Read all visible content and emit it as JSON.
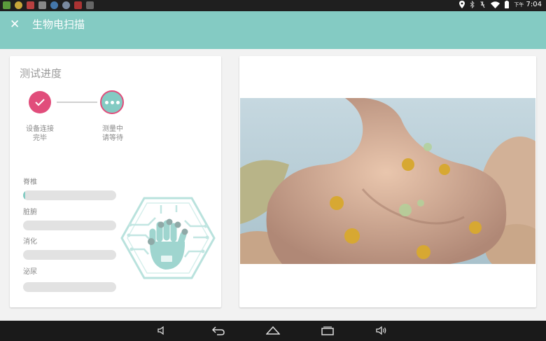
{
  "status_bar": {
    "notification_icons": [
      "gallery-icon",
      "sun-icon",
      "app-icon",
      "image-icon",
      "globe-icon",
      "globe-icon",
      "calendar-icon",
      "app-icon"
    ],
    "ampm": "下午",
    "time": "7:04",
    "battery_color": "#ffffff"
  },
  "app_bar": {
    "title": "生物电扫描",
    "close_icon": "close-icon",
    "color": "#84cbc3"
  },
  "progress": {
    "title": "测试进度",
    "steps": [
      {
        "label": "设备连接\n完毕",
        "state": "done",
        "icon": "check-icon"
      },
      {
        "label": "测量中\n请等待",
        "state": "active",
        "icon": "more-dots-icon"
      }
    ]
  },
  "metrics": [
    {
      "label": "脊椎",
      "progress": 0.02
    },
    {
      "label": "脏腑",
      "progress": 0
    },
    {
      "label": "消化",
      "progress": 0
    },
    {
      "label": "泌尿",
      "progress": 0
    }
  ],
  "emblem": {
    "icon": "hand-circuit-hexagon-icon"
  },
  "animation": {
    "subject": "stomach-illustration",
    "background": "#b9cfd9"
  },
  "nav_bar": {
    "buttons": [
      "volume-down-icon",
      "back-icon",
      "home-icon",
      "recents-icon",
      "volume-up-icon"
    ]
  },
  "colors": {
    "accent": "#84cbc3",
    "pink": "#e14d7b",
    "track": "#e2e2e2"
  }
}
